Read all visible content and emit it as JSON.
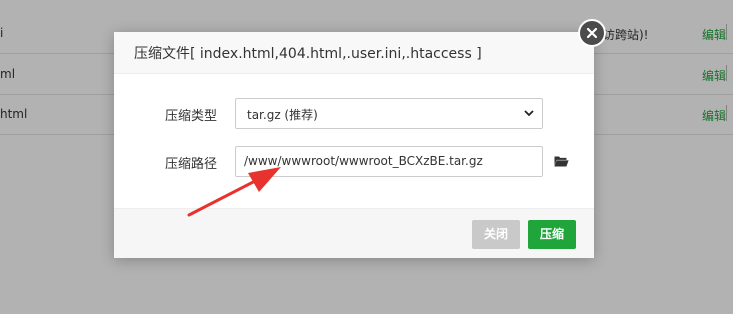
{
  "background_table": {
    "rows": [
      {
        "name": "i",
        "note": "访跨站)!",
        "edit": "编辑"
      },
      {
        "name": "ml",
        "note": "",
        "edit": "编辑"
      },
      {
        "name": "html",
        "note": "",
        "edit": "编辑"
      }
    ]
  },
  "dialog": {
    "title": "压缩文件[ index.html,404.html,.user.ini,.htaccess ]",
    "type_label": "压缩类型",
    "type_value": "tar.gz (推荐)",
    "path_label": "压缩路径",
    "path_value": "/www/wwwroot/wwwroot_BCXzBE.tar.gz",
    "close_button": "关闭",
    "compress_button": "压缩"
  },
  "colors": {
    "accent_green": "#20a53a",
    "arrow_red": "#e8322d",
    "close_disabled": "#c9c9c9"
  },
  "icons": {
    "close": "close-icon",
    "folder": "folder-open-icon",
    "caret": "chevron-down-icon"
  }
}
